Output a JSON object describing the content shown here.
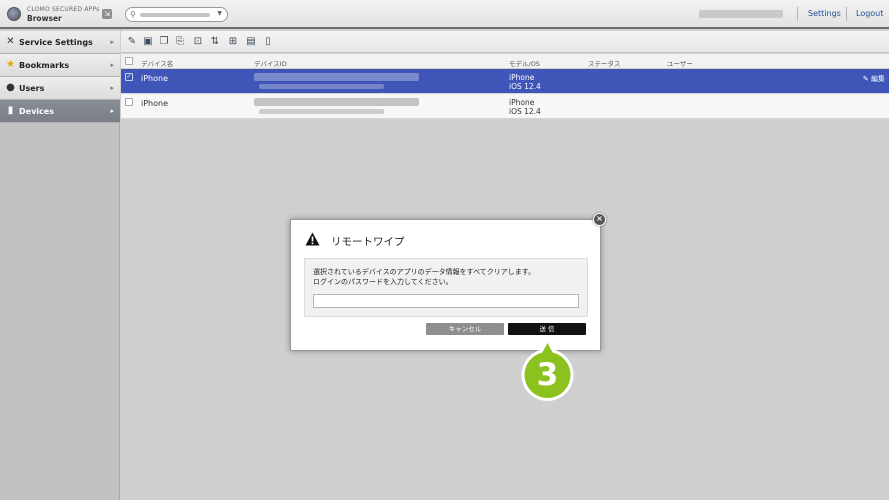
{
  "app": {
    "title_line1": "CLOMO SECURED APPs",
    "title_line2": "Browser"
  },
  "header": {
    "settings": "Settings",
    "logout": "Logout"
  },
  "sidebar": {
    "items": [
      {
        "label": "Service Settings",
        "icon": "tools-icon"
      },
      {
        "label": "Bookmarks",
        "icon": "star-icon"
      },
      {
        "label": "Users",
        "icon": "user-icon"
      },
      {
        "label": "Devices",
        "icon": "device-icon",
        "active": true
      }
    ]
  },
  "table": {
    "columns": [
      "デバイス名",
      "デバイスID",
      "モデル/OS",
      "ステータス",
      "ユーザー"
    ],
    "rows": [
      {
        "name": "iPhone",
        "model": "iPhone",
        "os": "iOS 12.4",
        "selected": true,
        "edit": "編集"
      },
      {
        "name": "iPhone",
        "model": "iPhone",
        "os": "iOS 12.4",
        "selected": false
      }
    ]
  },
  "dialog": {
    "title": "リモートワイプ",
    "message_line1": "選択されているデバイスのアプリのデータ情報をすべてクリアします。",
    "message_line2": "ログインのパスワードを入力してください。",
    "password_value": "",
    "cancel": "キャンセル",
    "send": "送 信"
  },
  "step_marker": {
    "number": "3",
    "color": "#8cc21f"
  },
  "colors": {
    "selected_row": "#3f55b7",
    "active_sidebar": "#808590"
  }
}
